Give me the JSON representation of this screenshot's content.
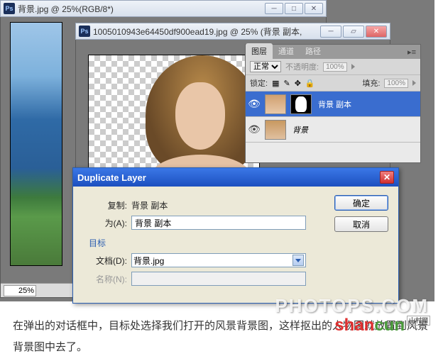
{
  "window1": {
    "title": "背景.jpg @ 25%(RGB/8*)",
    "zoom": "25%"
  },
  "window2": {
    "title": "1005010943e64450df900ead19.jpg @ 25% (背景 副本,"
  },
  "layers_panel": {
    "tabs": [
      "图层",
      "通道",
      "路径"
    ],
    "blend_mode": "正常",
    "opacity_label": "不透明度:",
    "opacity_value": "100%",
    "lock_label": "锁定:",
    "fill_label": "填充:",
    "fill_value": "100%",
    "layers": [
      {
        "name": "背景 副本",
        "selected": true,
        "has_mask": true
      },
      {
        "name": "背景",
        "selected": false,
        "locked": true
      }
    ]
  },
  "dialog": {
    "title": "Duplicate Layer",
    "duplicate_label": "复制:",
    "duplicate_value": "背景 副本",
    "as_label": "为(A):",
    "as_value": "背景 副本",
    "destination_label": "目标",
    "document_label": "文档(D):",
    "document_value": "背景.jpg",
    "name_label": "名称(N):",
    "name_value": "",
    "ok": "确定",
    "cancel": "取消"
  },
  "caption": "在弹出的对话框中，目标处选择我们打开的风景背景图，这样抠出的人物图就放置到风景背景图中去了。",
  "watermark1": "PHOTOPS.COM",
  "watermark2a": "shan",
  "watermark2b": "cun",
  "watermark2tag": "山村网"
}
